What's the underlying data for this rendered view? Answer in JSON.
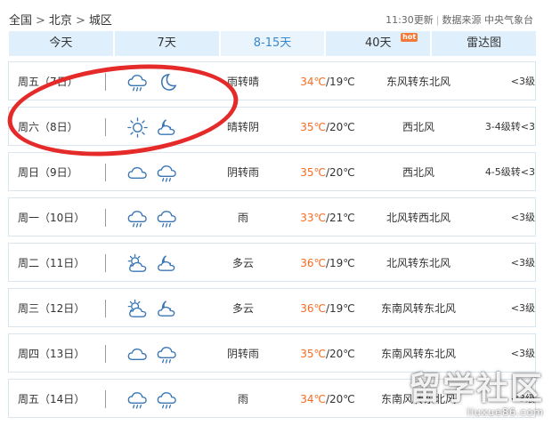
{
  "breadcrumb": {
    "items": [
      "全国",
      "北京",
      "城区"
    ],
    "separator": ">"
  },
  "header": {
    "update_time": "11:30更新",
    "source": "数据来源 中央气象台"
  },
  "tabs": [
    {
      "label": "今天"
    },
    {
      "label": "7天"
    },
    {
      "label": "8-15天",
      "active": true
    },
    {
      "label": "40天",
      "badge": "hot"
    },
    {
      "label": "雷达图"
    }
  ],
  "rows": [
    {
      "day": "周五（7日）",
      "icons": [
        "rain-cloud-icon",
        "moon-icon"
      ],
      "desc": "雨转晴",
      "high": "34℃",
      "low": "/19℃",
      "wind": "东风转东北风",
      "level": "<3级"
    },
    {
      "day": "周六（8日）",
      "icons": [
        "sun-icon",
        "moon-cloud-icon"
      ],
      "desc": "晴转阴",
      "high": "35℃",
      "low": "/20℃",
      "wind": "西北风",
      "level": "3-4级转<3"
    },
    {
      "day": "周日（9日）",
      "icons": [
        "cloud-icon",
        "rain-cloud-icon"
      ],
      "desc": "阴转雨",
      "high": "35℃",
      "low": "/20℃",
      "wind": "西北风",
      "level": "4-5级转<3"
    },
    {
      "day": "周一（10日）",
      "icons": [
        "rain-cloud-icon",
        "rain-cloud-icon"
      ],
      "desc": "雨",
      "high": "33℃",
      "low": "/21℃",
      "wind": "北风转西北风",
      "level": "<3级"
    },
    {
      "day": "周二（11日）",
      "icons": [
        "sun-cloud-icon",
        "moon-cloud-icon"
      ],
      "desc": "多云",
      "high": "36℃",
      "low": "/19℃",
      "wind": "北风转东北风",
      "level": "<3级"
    },
    {
      "day": "周三（12日）",
      "icons": [
        "sun-cloud-icon",
        "moon-cloud-icon"
      ],
      "desc": "多云",
      "high": "36℃",
      "low": "/19℃",
      "wind": "东南风转东北风",
      "level": "<3级"
    },
    {
      "day": "周四（13日）",
      "icons": [
        "cloud-icon",
        "rain-cloud-icon"
      ],
      "desc": "阴转雨",
      "high": "35℃",
      "low": "/20℃",
      "wind": "东南风转东北风",
      "level": "<3级"
    },
    {
      "day": "周五（14日）",
      "icons": [
        "rain-cloud-icon",
        "rain-cloud-icon"
      ],
      "desc": "雨",
      "high": "34℃",
      "low": "/20℃",
      "wind": "东南风转东北风",
      "level": "<3级"
    }
  ],
  "watermark": {
    "big": "留学社区",
    "small": "liuxue86.com"
  },
  "colors": {
    "tab_bg": "#dfeffc",
    "tab_active_text": "#3b88c9",
    "high_temp": "#f36c21",
    "icon_stroke": "#3a76b5",
    "ring": "#e52a2a"
  }
}
